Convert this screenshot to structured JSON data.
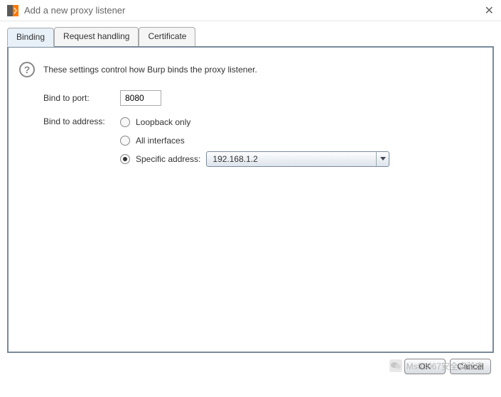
{
  "window": {
    "title": "Add a new proxy listener"
  },
  "tabs": {
    "items": [
      {
        "label": "Binding",
        "active": true
      },
      {
        "label": "Request handling",
        "active": false
      },
      {
        "label": "Certificate",
        "active": false
      }
    ]
  },
  "content": {
    "description": "These settings control how Burp binds the proxy listener.",
    "port_label": "Bind to port:",
    "port_value": "8080",
    "address_label": "Bind to address:",
    "radios": {
      "loopback": "Loopback only",
      "all": "All interfaces",
      "specific": "Specific address:"
    },
    "specific_value": "192.168.1.2"
  },
  "footer": {
    "ok": "OK",
    "cancel": "Cancel"
  },
  "watermark": {
    "text": "Ms08067安全实验室"
  }
}
